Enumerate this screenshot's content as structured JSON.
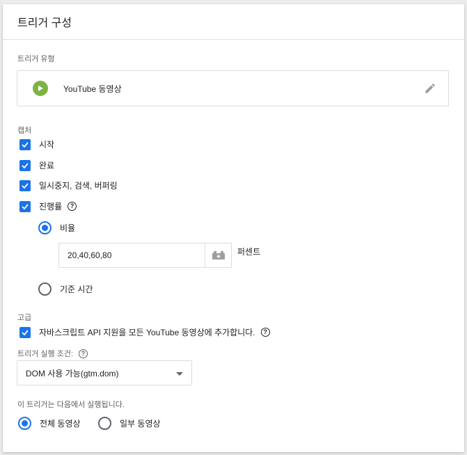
{
  "header": {
    "title": "트리거 구성"
  },
  "trigger_type": {
    "label": "트리거 유형",
    "name": "YouTube 동영상",
    "icon": "play-icon",
    "icon_color": "#7cb342"
  },
  "capture": {
    "label": "캡처",
    "options": [
      {
        "label": "시작",
        "checked": true
      },
      {
        "label": "완료",
        "checked": true
      },
      {
        "label": "일시중지, 검색, 버퍼링",
        "checked": true
      },
      {
        "label": "진행률",
        "checked": true
      }
    ],
    "progress": {
      "ratio_label": "비율",
      "ratio_selected": true,
      "ratio_value": "20,40,60,80",
      "unit": "퍼센트",
      "time_label": "기준 시간",
      "time_selected": false
    }
  },
  "advanced": {
    "label": "고급",
    "js_api_label": "자바스크립트 API 지원을 모든 YouTube 동영상에 추가합니다.",
    "js_api_checked": true,
    "fire_condition_label": "트리거 실행 조건:",
    "fire_condition_value": "DOM 사용 가능(gtm.dom)"
  },
  "scope": {
    "label": "이 트리거는 다음에서 실행됩니다.",
    "all_label": "전체 동영상",
    "some_label": "일부 동영상",
    "selected": "all"
  },
  "colors": {
    "accent": "#1a73e8",
    "border": "#dadce0"
  }
}
